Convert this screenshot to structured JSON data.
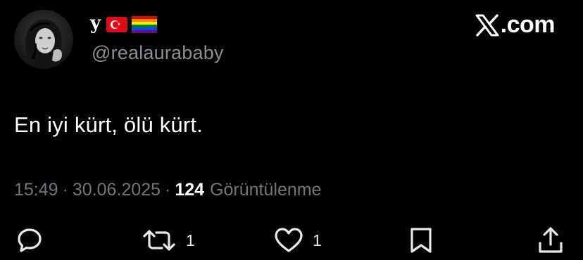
{
  "author": {
    "display_name": "y",
    "flags": [
      "turkey-flag",
      "rainbow-flag"
    ],
    "handle": "@realaurababy"
  },
  "brand": {
    "label": ".com",
    "icon": "x-logo-icon"
  },
  "tweet": {
    "text": "En iyi kürt, ölü kürt."
  },
  "meta": {
    "time": "15:49",
    "separator": "·",
    "date": "30.06.2025",
    "views_count": "124",
    "views_label": "Görüntülenme"
  },
  "actions": {
    "reply": {
      "icon": "reply-icon"
    },
    "retweet": {
      "icon": "retweet-icon",
      "count": "1"
    },
    "like": {
      "icon": "heart-icon",
      "count": "1"
    },
    "bookmark": {
      "icon": "bookmark-icon"
    },
    "share": {
      "icon": "share-icon"
    }
  },
  "colors": {
    "background": "#000000",
    "primary_text": "#ffffff",
    "secondary_text": "#71767b"
  }
}
